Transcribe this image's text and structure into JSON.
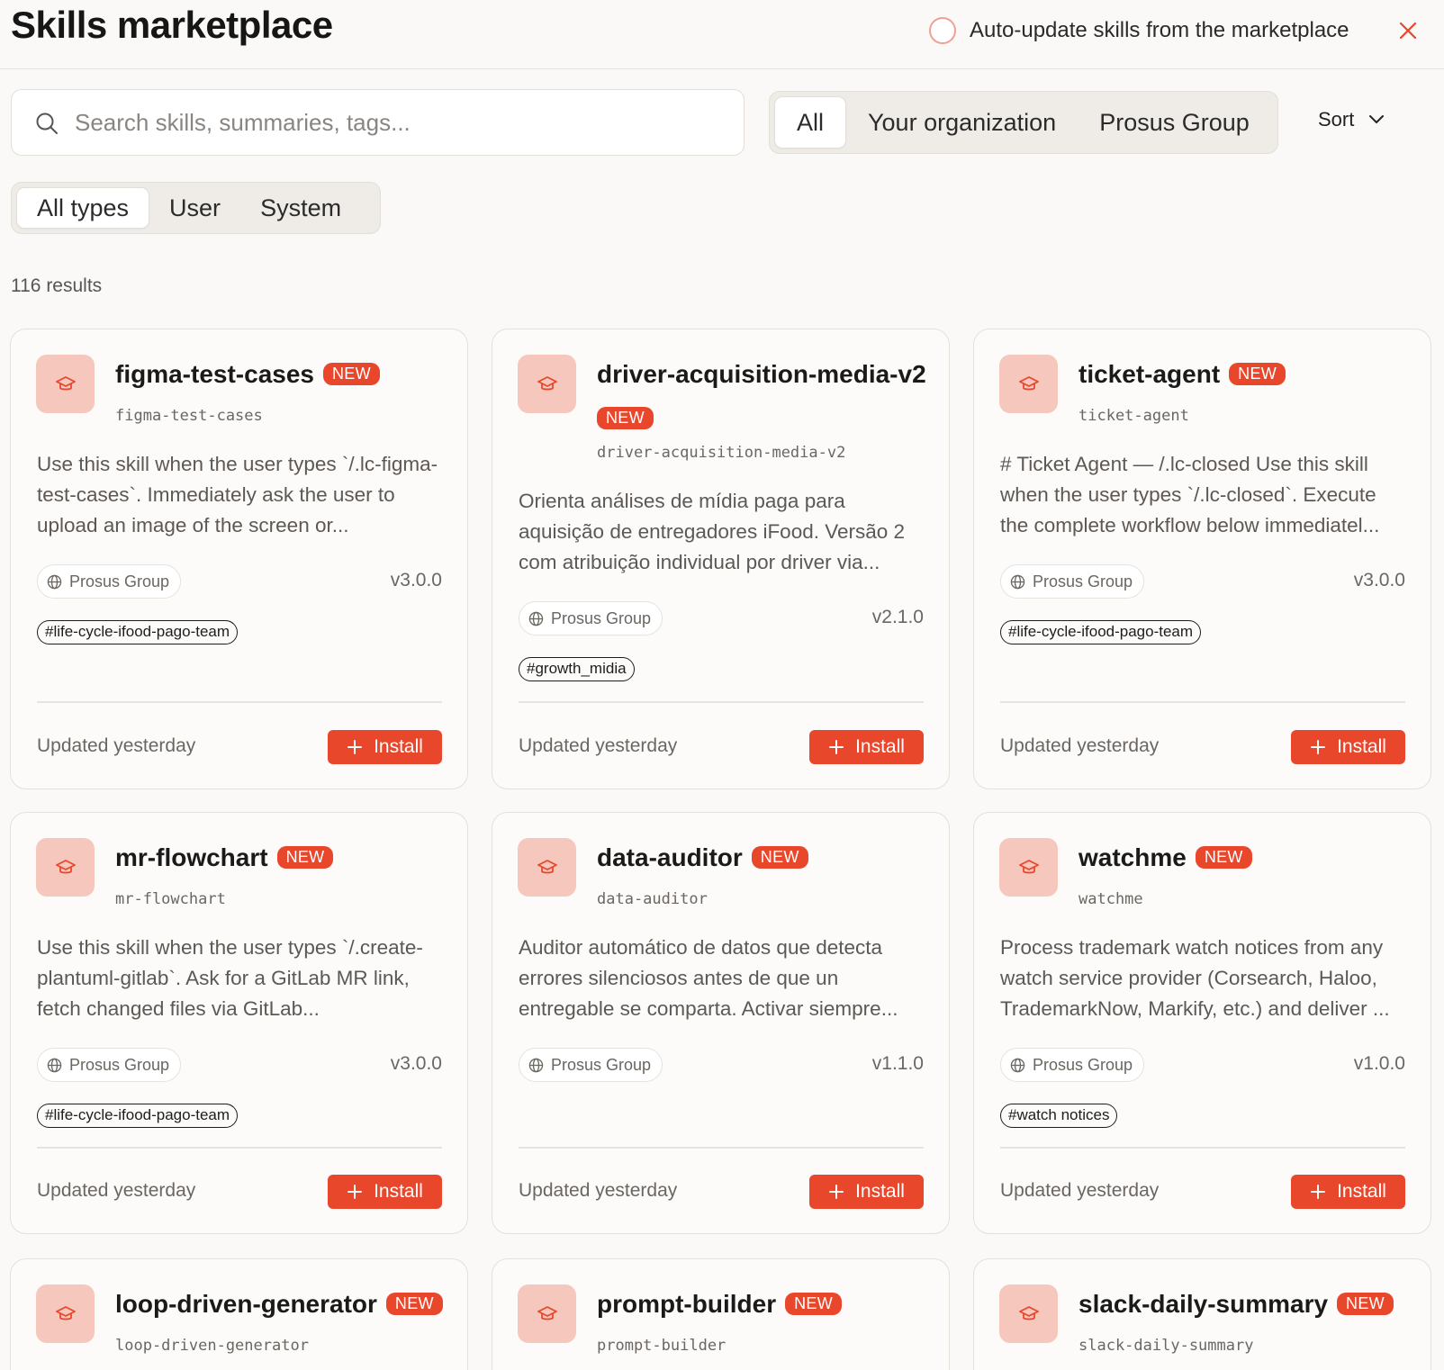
{
  "header": {
    "title": "Skills marketplace",
    "auto_update_label": "Auto-update skills from the marketplace"
  },
  "search": {
    "placeholder": "Search skills, summaries, tags..."
  },
  "scope_filter": {
    "items": [
      "All",
      "Your organization",
      "Prosus Group"
    ],
    "selected": "All"
  },
  "type_filter": {
    "items": [
      "All types",
      "User",
      "System"
    ],
    "selected": "All types"
  },
  "sort_label": "Sort",
  "results_count": "116 results",
  "badge_label": "NEW",
  "install_label": "Install",
  "colors": {
    "accent": "#e8472c",
    "icon_bg": "#f6c7bc",
    "page_bg": "#faf9f7"
  },
  "icons": {
    "skill": "graduation-cap-icon",
    "org": "globe-icon",
    "install": "plus-icon",
    "close": "close-icon",
    "search": "search-icon",
    "sort": "chevron-down-icon"
  },
  "skills": [
    {
      "name": "figma-test-cases",
      "slug": "figma-test-cases",
      "description": "Use this skill when the user types `/.lc-figma-test-cases`. Immediately ask the user to upload an image of the screen or...",
      "org": "Prosus Group",
      "version": "v3.0.0",
      "tag": "#life-cycle-ifood-pago-team",
      "updated": "Updated yesterday"
    },
    {
      "name": "driver-acquisition-media-v2",
      "slug": "driver-acquisition-media-v2",
      "description": "Orienta análises de mídia paga para aquisição de entregadores iFood. Versão 2 com atribuição individual por driver via...",
      "org": "Prosus Group",
      "version": "v2.1.0",
      "tag": "#growth_midia",
      "updated": "Updated yesterday"
    },
    {
      "name": "ticket-agent",
      "slug": "ticket-agent",
      "description": "# Ticket Agent — /.lc-closed Use this skill when the user types `/.lc-closed`. Execute the complete workflow below immediatel...",
      "org": "Prosus Group",
      "version": "v3.0.0",
      "tag": "#life-cycle-ifood-pago-team",
      "updated": "Updated yesterday"
    },
    {
      "name": "mr-flowchart",
      "slug": "mr-flowchart",
      "description": "Use this skill when the user types `/.create-plantuml-gitlab`. Ask for a GitLab MR link, fetch changed files via GitLab...",
      "org": "Prosus Group",
      "version": "v3.0.0",
      "tag": "#life-cycle-ifood-pago-team",
      "updated": "Updated yesterday"
    },
    {
      "name": "data-auditor",
      "slug": "data-auditor",
      "description": "Auditor automático de datos que detecta errores silenciosos antes de que un entregable se comparta. Activar siempre...",
      "org": "Prosus Group",
      "version": "v1.1.0",
      "tag": "",
      "updated": "Updated yesterday"
    },
    {
      "name": "watchme",
      "slug": "watchme",
      "description": "Process trademark watch notices from any watch service provider (Corsearch, Haloo, TrademarkNow, Markify, etc.) and deliver ...",
      "org": "Prosus Group",
      "version": "v1.0.0",
      "tag": "#watch notices",
      "updated": "Updated yesterday"
    },
    {
      "name": "loop-driven-generator",
      "slug": "loop-driven-generator"
    },
    {
      "name": "prompt-builder",
      "slug": "prompt-builder"
    },
    {
      "name": "slack-daily-summary",
      "slug": "slack-daily-summary"
    }
  ]
}
